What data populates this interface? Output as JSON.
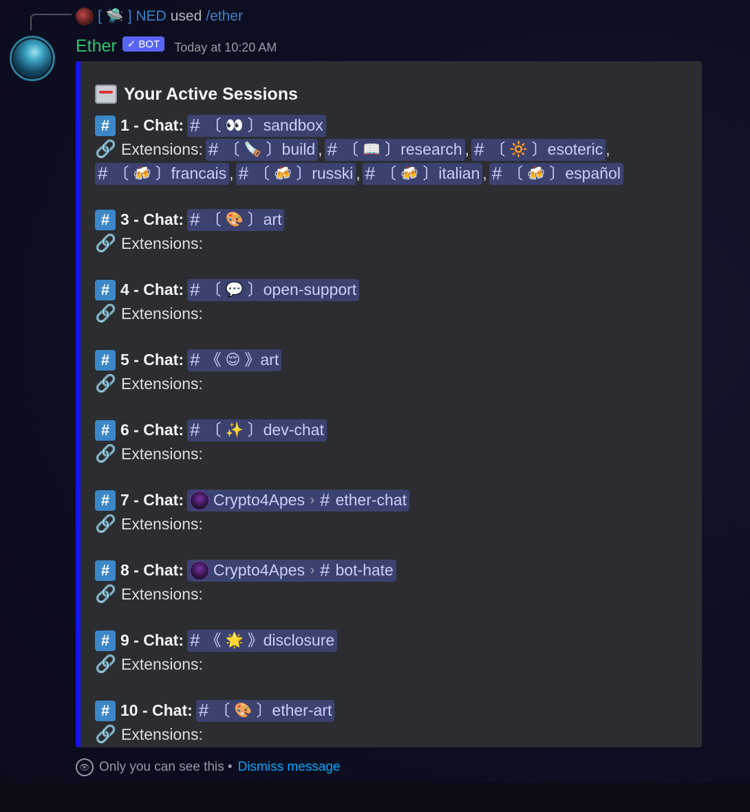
{
  "reply": {
    "bracket_open": "[",
    "bracket_icon": "🛸",
    "bracket_close": "]",
    "name": "NED",
    "used": "used",
    "command": "/ether"
  },
  "message": {
    "author": "Ether",
    "badge": "BOT",
    "timestamp": "Today at 10:20 AM"
  },
  "embed": {
    "title": "Your Active Sessions",
    "color": "#1414ee",
    "sessions": [
      {
        "label": "1 - Chat:",
        "channel": {
          "hash": "#",
          "open": "〔",
          "emoji": "👀",
          "close": "〕",
          "name": "sandbox"
        },
        "extensions_label": "Extensions:",
        "extensions": [
          {
            "hash": "#",
            "open": "〔",
            "emoji": "🪚",
            "close": "〕",
            "name": "build"
          },
          {
            "hash": "#",
            "open": "〔",
            "emoji": "📖",
            "close": "〕",
            "name": "research"
          },
          {
            "hash": "#",
            "open": "〔",
            "emoji": "🔆",
            "close": "〕",
            "name": "esoteric"
          },
          {
            "hash": "#",
            "open": "〔",
            "emoji": "🍻",
            "close": "〕",
            "name": "francais"
          },
          {
            "hash": "#",
            "open": "〔",
            "emoji": "🍻",
            "close": "〕",
            "name": "russki"
          },
          {
            "hash": "#",
            "open": "〔",
            "emoji": "🍻",
            "close": "〕",
            "name": "italian"
          },
          {
            "hash": "#",
            "open": "〔",
            "emoji": "🍻",
            "close": "〕",
            "name": "español"
          }
        ]
      },
      {
        "label": "3 - Chat:",
        "channel": {
          "hash": "#",
          "open": "〔",
          "emoji": "🎨",
          "close": "〕",
          "name": "art"
        },
        "extensions_label": "Extensions:"
      },
      {
        "label": "4 - Chat:",
        "channel": {
          "hash": "#",
          "open": "〔",
          "emoji": "💬",
          "close": "〕",
          "name": "open-support"
        },
        "extensions_label": "Extensions:"
      },
      {
        "label": "5 - Chat:",
        "channel": {
          "hash": "#",
          "open": "《",
          "emoji": "😌",
          "close": "》",
          "name": "art"
        },
        "extensions_label": "Extensions:"
      },
      {
        "label": "6 - Chat:",
        "channel": {
          "hash": "#",
          "open": "〔",
          "emoji": "✨",
          "close": "〕",
          "name": "dev-chat"
        },
        "extensions_label": "Extensions:"
      },
      {
        "label": "7 - Chat:",
        "channel": {
          "guild": "Crypto4Apes",
          "chevron": "›",
          "hash": "#",
          "name": "ether-chat"
        },
        "extensions_label": "Extensions:"
      },
      {
        "label": "8 - Chat:",
        "channel": {
          "guild": "Crypto4Apes",
          "chevron": "›",
          "hash": "#",
          "name": "bot-hate"
        },
        "extensions_label": "Extensions:"
      },
      {
        "label": "9 - Chat:",
        "channel": {
          "hash": "#",
          "open": "《",
          "emoji": "🌟",
          "close": "》",
          "name": "disclosure"
        },
        "extensions_label": "Extensions:"
      },
      {
        "label": "10 - Chat:",
        "channel": {
          "hash": "#",
          "open": "〔",
          "emoji": "🎨",
          "close": "〕",
          "name": "ether-art"
        },
        "extensions_label": "Extensions:"
      }
    ]
  },
  "footer": {
    "text": "Only you can see this •",
    "dismiss": "Dismiss message"
  },
  "icons": {
    "session_hash": "#",
    "link": "🔗",
    "eye": "👁",
    "check": "✓"
  }
}
